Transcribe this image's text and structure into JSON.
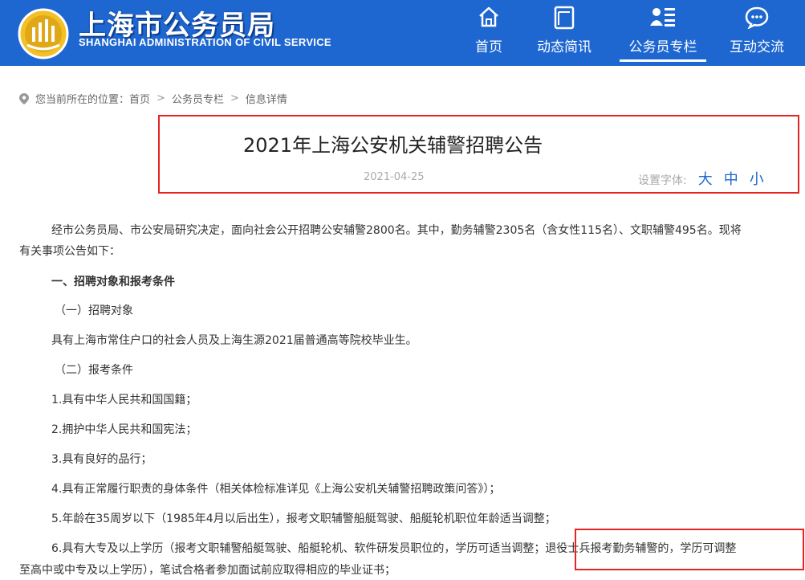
{
  "header": {
    "logo_cn": "上海市公务员局",
    "logo_en": "SHANGHAI ADMINISTRATION OF CIVIL SERVICE",
    "nav": [
      {
        "label": "首页",
        "icon": "home-icon"
      },
      {
        "label": "动态简讯",
        "icon": "news-icon"
      },
      {
        "label": "公务员专栏",
        "icon": "column-icon",
        "active": true
      },
      {
        "label": "互动交流",
        "icon": "chat-icon"
      }
    ],
    "bg_color": "#1e67d1"
  },
  "breadcrumb": {
    "prefix": "您当前所在的位置：",
    "items": [
      "首页",
      "公务员专栏",
      "信息详情"
    ]
  },
  "article": {
    "title": "2021年上海公安机关辅警招聘公告",
    "date": "2021-04-25",
    "font_setting_label": "设置字体:",
    "font_options": [
      "大",
      "中",
      "小"
    ],
    "paragraphs": [
      "经市公务员局、市公安局研究决定，面向社会公开招聘公安辅警2800名。其中，勤务辅警2305名（含女性115名）、文职辅警495名。现将",
      "有关事项公告如下：",
      "一、招聘对象和报考条件",
      "（一）招聘对象",
      "具有上海市常住户口的社会人员及上海生源2021届普通高等院校毕业生。",
      "（二）报考条件",
      "1.具有中华人民共和国国籍；",
      "2.拥护中华人民共和国宪法；",
      "3.具有良好的品行；",
      "4.具有正常履行职责的身体条件（相关体检标准详见《上海公安机关辅警招聘政策问答》）；",
      "5.年龄在35周岁以下（1985年4月以后出生），报考文职辅警船艇驾驶、船艇轮机职位年龄适当调整；",
      "6.具有大专及以上学历（报考文职辅警船艇驾驶、船艇轮机、软件研发员职位的，学历可适当调整；退役士兵报考勤务辅警的，学历可调整",
      "至高中或中专及以上学历），笔试合格者参加面试前应取得相应的毕业证书；"
    ]
  }
}
